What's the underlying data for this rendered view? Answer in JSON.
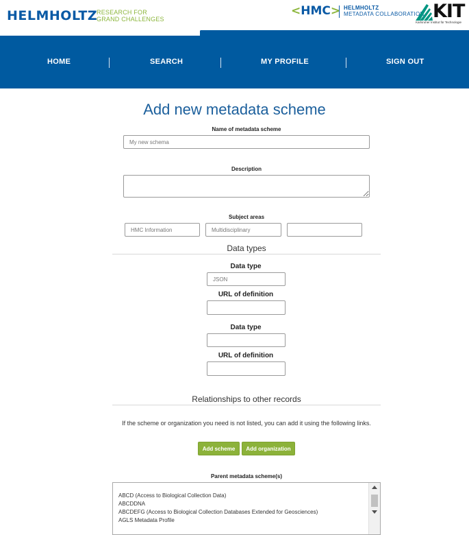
{
  "header": {
    "helmholtz_logo": "HELMHOLTZ",
    "helmholtz_tagline_1": "RESEARCH FOR",
    "helmholtz_tagline_2": "GRAND CHALLENGES",
    "hmc_logo": "HMC",
    "hmc_line1": "HELMHOLTZ",
    "hmc_line2": "METADATA COLLABORATION",
    "kit_logo": "KIT",
    "kit_subtitle": "Karlsruher Institut für Technologie"
  },
  "nav": {
    "items": [
      "HOME",
      "SEARCH",
      "MY PROFILE",
      "SIGN OUT"
    ],
    "color": "#005aa0"
  },
  "form": {
    "title": "Add new metadata scheme",
    "name_label": "Name of metadata scheme",
    "name_placeholder": "My new schema",
    "description_label": "Description",
    "description_value": "",
    "subject_label": "Subject areas",
    "subjects": [
      "HMC Information",
      "Multidisciplinary",
      ""
    ]
  },
  "data_types": {
    "heading": "Data types",
    "entries": [
      {
        "type_label": "Data type",
        "type_value": "JSON",
        "url_label": "URL of definition",
        "url_value": ""
      },
      {
        "type_label": "Data type",
        "type_value": "",
        "url_label": "URL of definition",
        "url_value": ""
      }
    ]
  },
  "relationships": {
    "heading": "Relationships to other records",
    "info_text": "If the scheme or organization you need is not listed, you can add it using the following links.",
    "add_scheme_button": "Add scheme",
    "add_organization_button": "Add organization",
    "parent_label": "Parent metadata scheme(s)",
    "parent_options": [
      "ABCD (Access to Biological Collection Data)",
      "ABCDDNA",
      "ABCDEFG (Access to Biological Collection Databases Extended for Geosciences)",
      "AGLS Metadata Profile"
    ]
  },
  "colors": {
    "brand_blue": "#005aa0",
    "accent_green": "#8cb23a",
    "title_blue": "#1b5f9c"
  }
}
